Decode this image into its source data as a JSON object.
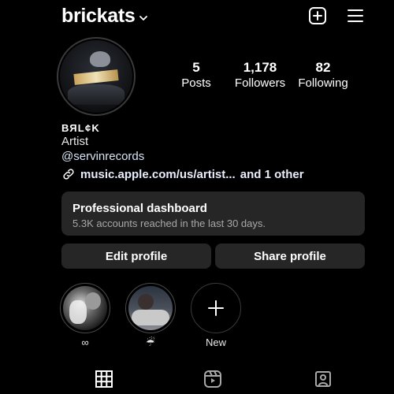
{
  "header": {
    "username": "brickats",
    "icons": [
      "chevron-down-icon",
      "add-post-icon",
      "menu-icon"
    ]
  },
  "profile": {
    "stats": {
      "posts": {
        "value": "5",
        "label": "Posts"
      },
      "followers": {
        "value": "1,178",
        "label": "Followers"
      },
      "following": {
        "value": "82",
        "label": "Following"
      }
    },
    "display_name": "ВЯL¢K",
    "category": "Artist",
    "handle": "@servinrecords",
    "link_text": "music.apple.com/us/artist...",
    "link_more": "and 1 other"
  },
  "dashboard": {
    "title": "Professional dashboard",
    "subtitle": "5.3K accounts reached in the last 30 days."
  },
  "actions": {
    "edit": "Edit profile",
    "share": "Share profile"
  },
  "highlights": [
    {
      "label": "∞"
    },
    {
      "label": "☔"
    },
    {
      "label": "New"
    }
  ],
  "tabs": [
    "grid-icon",
    "reels-icon",
    "tagged-icon"
  ],
  "colors": {
    "background": "#000000",
    "card": "#262626",
    "secondary_text": "#a8a8a8",
    "link_text": "#e8eefb"
  }
}
